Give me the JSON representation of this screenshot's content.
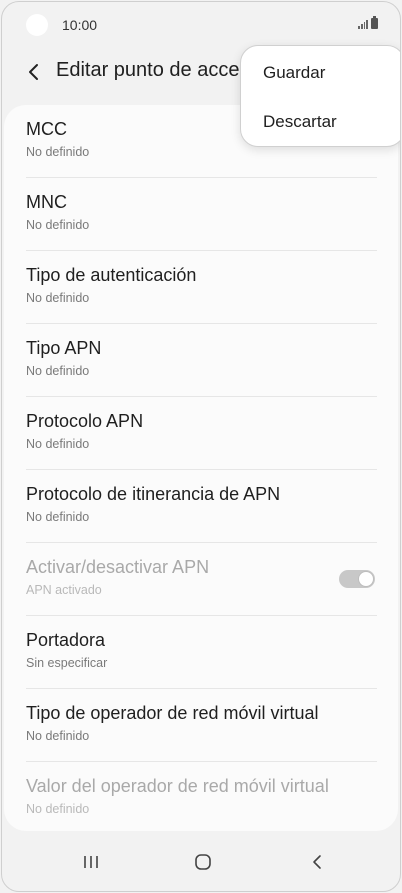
{
  "status_bar": {
    "time": "10:00"
  },
  "header": {
    "title": "Editar punto de acceso"
  },
  "menu": {
    "items": [
      {
        "label": "Guardar"
      },
      {
        "label": "Descartar"
      }
    ]
  },
  "settings": {
    "items": [
      {
        "title": "MCC",
        "subtitle": "No definido"
      },
      {
        "title": "MNC",
        "subtitle": "No definido"
      },
      {
        "title": "Tipo de autenticación",
        "subtitle": "No definido"
      },
      {
        "title": "Tipo APN",
        "subtitle": "No definido"
      },
      {
        "title": "Protocolo APN",
        "subtitle": "No definido"
      },
      {
        "title": "Protocolo de itinerancia de APN",
        "subtitle": "No definido"
      },
      {
        "title": "Activar/desactivar APN",
        "subtitle": "APN activado",
        "toggle_on": true,
        "disabled": true
      },
      {
        "title": "Portadora",
        "subtitle": "Sin especificar"
      },
      {
        "title": "Tipo de operador de red móvil virtual",
        "subtitle": "No definido"
      },
      {
        "title": "Valor del operador de red móvil virtual",
        "subtitle": "No definido",
        "disabled": true
      }
    ]
  },
  "nav_bar": {
    "icons": [
      "recents-icon",
      "home-icon",
      "back-icon"
    ]
  },
  "colors": {
    "background": "#f2f2f2",
    "card": "#fbfbfb",
    "text": "#1f1f1f",
    "subtext": "#7a7a7a",
    "disabled": "#a9a9a9"
  }
}
